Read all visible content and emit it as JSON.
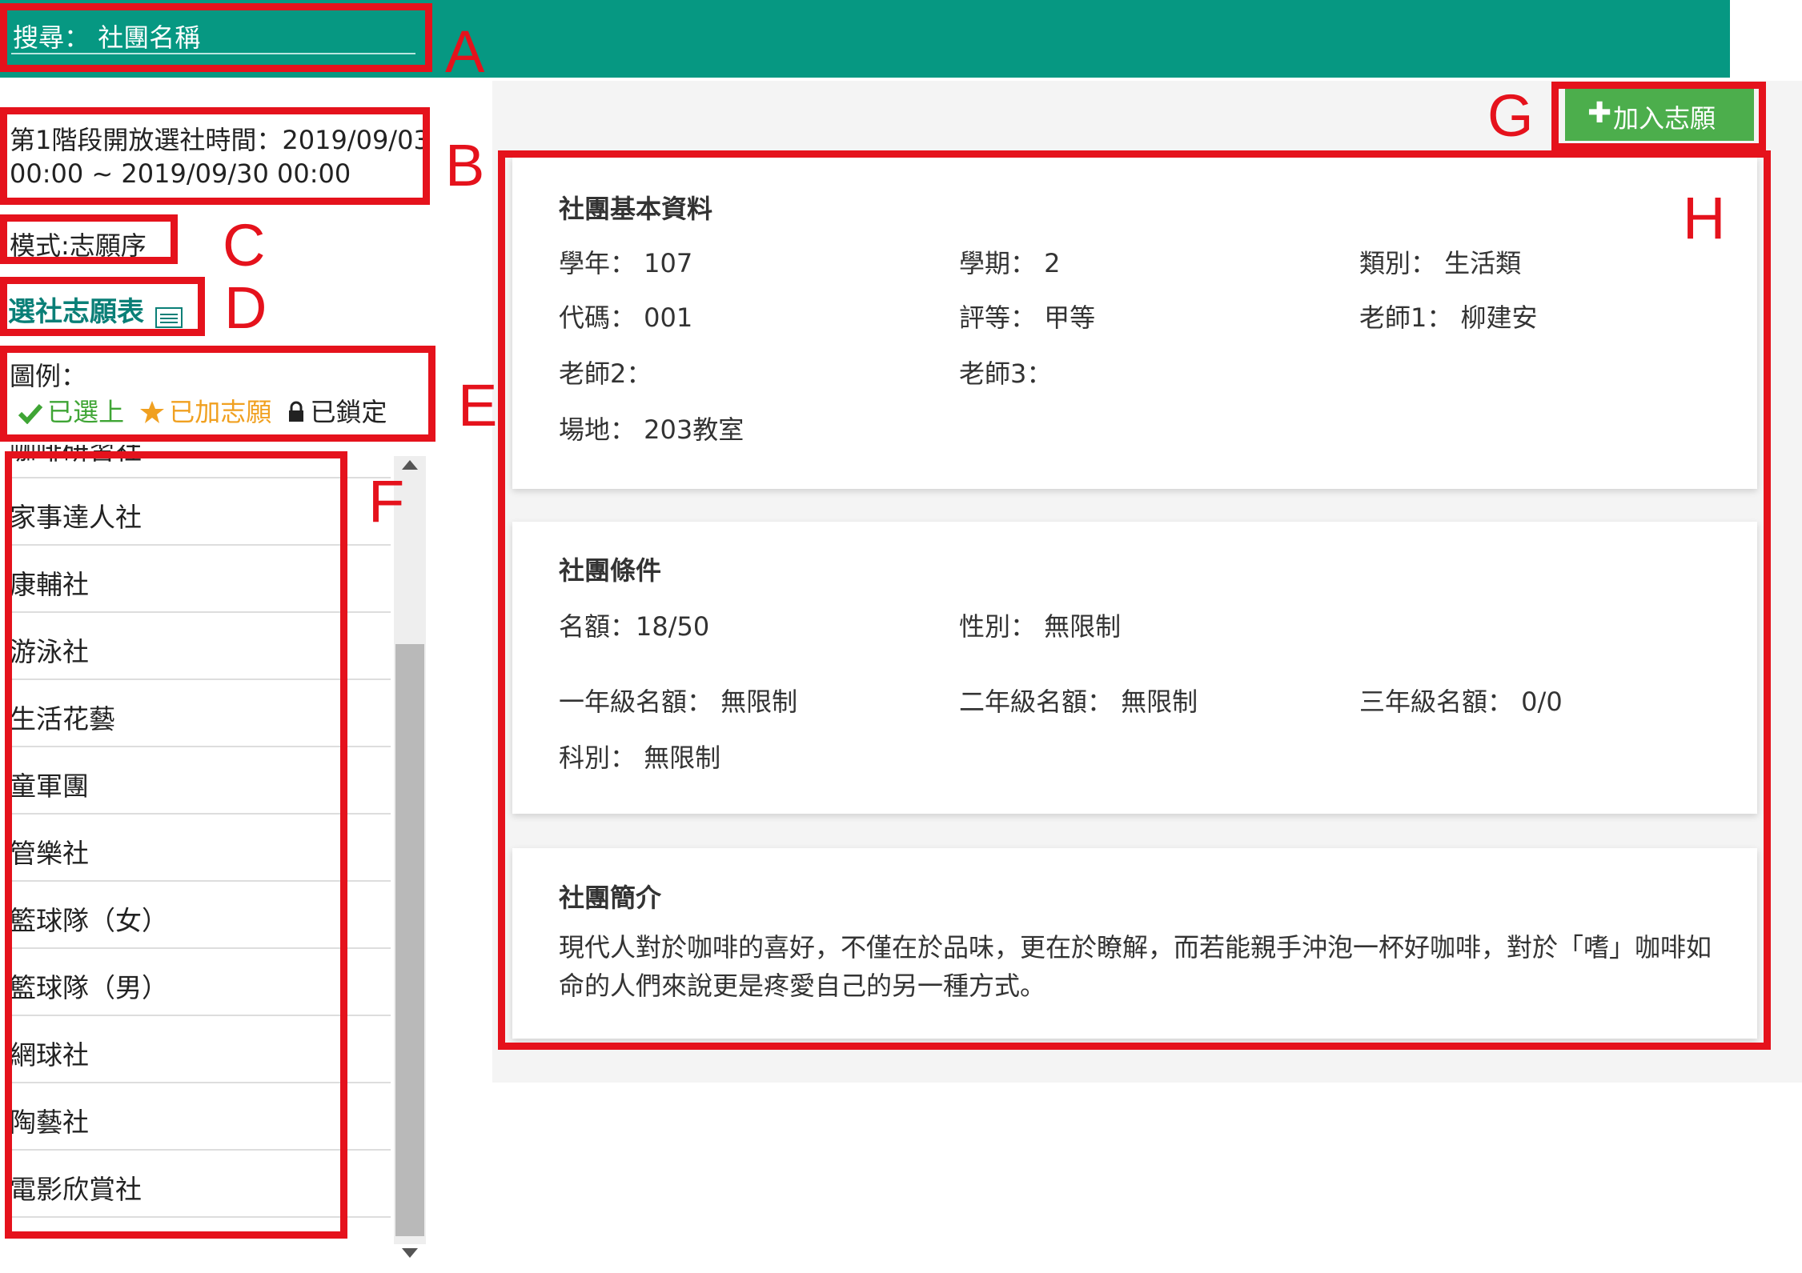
{
  "header": {
    "search_label": "搜尋：",
    "search_placeholder": "社團名稱",
    "accent_color": "#069882"
  },
  "sidebar": {
    "phase_time_line1": "第1階段開放選社時間：2019/09/03",
    "phase_time_line2": "00:00 ~ 2019/09/30 00:00",
    "mode": "模式:志願序",
    "wish_list_link": "選社志願表",
    "legend": {
      "title": "圖例：",
      "selected": "已選上",
      "wished": "已加志願",
      "locked": "已鎖定"
    },
    "clubs": [
      "咖啡研習社",
      "家事達人社",
      "康輔社",
      "游泳社",
      "生活花藝",
      "童軍團",
      "管樂社",
      "籃球隊（女）",
      "籃球隊（男）",
      "網球社",
      "陶藝社",
      "電影欣賞社"
    ]
  },
  "main": {
    "add_button": "加入志願",
    "basic": {
      "title": "社團基本資料",
      "year": "學年： 107",
      "semester": "學期： 2",
      "category": "類別： 生活類",
      "code": "代碼： 001",
      "grade": "評等： 甲等",
      "teacher1": "老師1： 柳建安",
      "teacher2": "老師2：",
      "teacher3": "老師3：",
      "venue": "場地： 203教室"
    },
    "conditions": {
      "title": "社團條件",
      "quota": "名額：18/50",
      "gender": "性別： 無限制",
      "grade1": "一年級名額： 無限制",
      "grade2": "二年級名額： 無限制",
      "grade3": "三年級名額： 0/0",
      "department": "科別： 無限制"
    },
    "intro": {
      "title": "社團簡介",
      "text": "現代人對於咖啡的喜好，不僅在於品味，更在於瞭解，而若能親手沖泡一杯好咖啡，對於「嗜」咖啡如命的人們來說更是疼愛自己的另一種方式。"
    }
  },
  "callouts": [
    "A",
    "B",
    "C",
    "D",
    "E",
    "F",
    "G",
    "H"
  ],
  "colors": {
    "callout": "#e5121c",
    "button": "#4cae4c",
    "link": "#0a7f77",
    "check": "#3fa535",
    "star": "#f0a020"
  }
}
